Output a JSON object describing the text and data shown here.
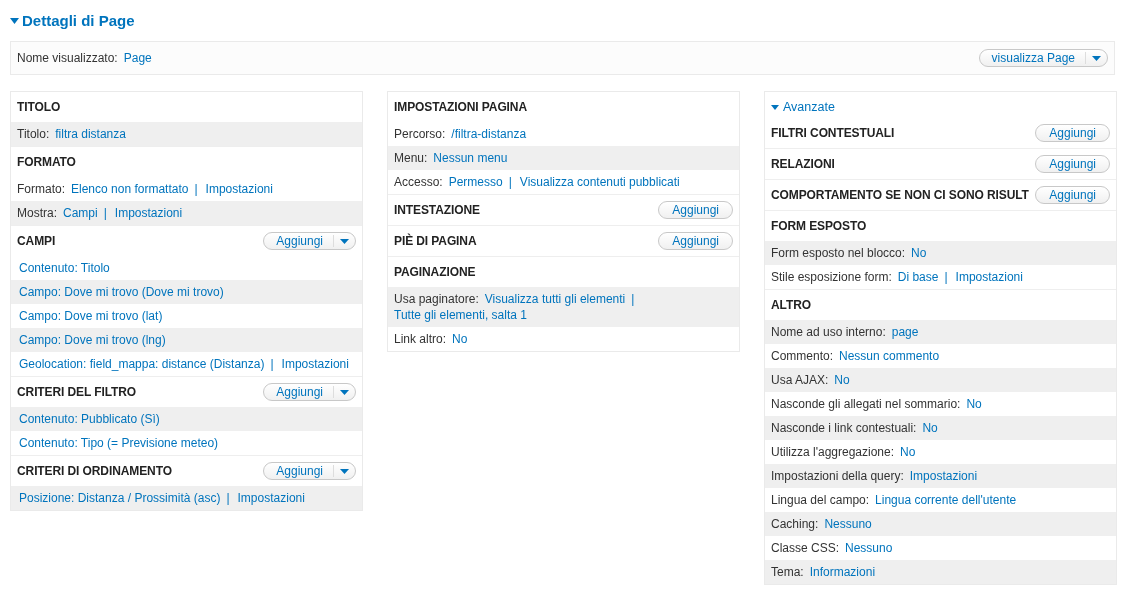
{
  "details": {
    "title": "Dettagli di Page",
    "expanded": true
  },
  "display_name": {
    "label": "Nome visualizzato:",
    "value": "Page",
    "button": "visualizza Page"
  },
  "columns": [
    {
      "sections": [
        {
          "title": "TITOLO",
          "rows": [
            {
              "label": "Titolo:",
              "links": [
                "filtra distanza"
              ],
              "shaded": true
            }
          ]
        },
        {
          "title": "FORMATO",
          "rows": [
            {
              "label": "Formato:",
              "links": [
                "Elenco non formattato",
                "Impostazioni"
              ],
              "separator": "|",
              "shaded": false
            },
            {
              "label": "Mostra:",
              "links": [
                "Campi",
                "Impostazioni"
              ],
              "separator": "|",
              "shaded": true
            }
          ]
        },
        {
          "title": "CAMPI",
          "add": {
            "label": "Aggiungi",
            "kind": "dropbutton"
          },
          "rows": [
            {
              "links": [
                "Contenuto: Titolo"
              ],
              "shaded": false
            },
            {
              "links": [
                "Campo: Dove mi trovo (Dove mi trovo)"
              ],
              "shaded": true
            },
            {
              "links": [
                "Campo: Dove mi trovo (lat)"
              ],
              "shaded": false
            },
            {
              "links": [
                "Campo: Dove mi trovo (lng)"
              ],
              "shaded": true
            },
            {
              "links": [
                "Geolocation: field_mappa: distance (Distanza)",
                "Impostazioni"
              ],
              "separator": "|",
              "shaded": false
            }
          ]
        },
        {
          "title": "CRITERI DEL FILTRO",
          "add": {
            "label": "Aggiungi",
            "kind": "dropbutton"
          },
          "rows": [
            {
              "links": [
                "Contenuto: Pubblicato (Sì)"
              ],
              "shaded": true
            },
            {
              "links": [
                "Contenuto: Tipo (= Previsione meteo)"
              ],
              "shaded": false
            }
          ]
        },
        {
          "title": "CRITERI DI ORDINAMENTO",
          "add": {
            "label": "Aggiungi",
            "kind": "dropbutton"
          },
          "rows": [
            {
              "links": [
                "Posizione: Distanza / Prossimità (asc)",
                "Impostazioni"
              ],
              "separator": "|",
              "shaded": true
            }
          ]
        }
      ]
    },
    {
      "sections": [
        {
          "title": "IMPOSTAZIONI PAGINA",
          "rows": [
            {
              "label": "Percorso:",
              "links": [
                "/filtra-distanza"
              ],
              "shaded": false
            },
            {
              "label": "Menu:",
              "links": [
                "Nessun menu"
              ],
              "shaded": true
            },
            {
              "label": "Accesso:",
              "links": [
                "Permesso",
                "Visualizza contenuti pubblicati"
              ],
              "separator": "|",
              "shaded": false
            }
          ]
        },
        {
          "title": "INTESTAZIONE",
          "add": {
            "label": "Aggiungi",
            "kind": "button"
          }
        },
        {
          "title": "PIÈ DI PAGINA",
          "add": {
            "label": "Aggiungi",
            "kind": "button"
          }
        },
        {
          "title": "PAGINAZIONE",
          "rows": [
            {
              "label": "Usa paginatore:",
              "links": [
                "Visualizza tutti gli elementi",
                "Tutte gli elementi, salta 1"
              ],
              "separator": "|",
              "shaded": true
            },
            {
              "label": "Link altro:",
              "links": [
                "No"
              ],
              "shaded": false
            }
          ]
        }
      ]
    },
    {
      "toggle": {
        "label": "Avanzate",
        "expanded": true
      },
      "sections": [
        {
          "title": "FILTRI CONTESTUALI",
          "add": {
            "label": "Aggiungi",
            "kind": "button"
          }
        },
        {
          "title": "RELAZIONI",
          "add": {
            "label": "Aggiungi",
            "kind": "button"
          }
        },
        {
          "title": "COMPORTAMENTO SE NON CI SONO RISULT",
          "add": {
            "label": "Aggiungi",
            "kind": "button"
          }
        },
        {
          "title": "FORM ESPOSTO",
          "rows": [
            {
              "label": "Form esposto nel blocco:",
              "links": [
                "No"
              ],
              "shaded": true
            },
            {
              "label": "Stile esposizione form:",
              "links": [
                "Di base",
                "Impostazioni"
              ],
              "separator": "|",
              "shaded": false
            }
          ]
        },
        {
          "title": "ALTRO",
          "rows": [
            {
              "label": "Nome ad uso interno:",
              "links": [
                "page"
              ],
              "shaded": true
            },
            {
              "label": "Commento:",
              "links": [
                "Nessun commento"
              ],
              "shaded": false
            },
            {
              "label": "Usa AJAX:",
              "links": [
                "No"
              ],
              "shaded": true
            },
            {
              "label": "Nasconde gli allegati nel sommario:",
              "links": [
                "No"
              ],
              "shaded": false
            },
            {
              "label": "Nasconde i link contestuali:",
              "links": [
                "No"
              ],
              "shaded": true
            },
            {
              "label": "Utilizza l'aggregazione:",
              "links": [
                "No"
              ],
              "shaded": false
            },
            {
              "label": "Impostazioni della query:",
              "links": [
                "Impostazioni"
              ],
              "shaded": true
            },
            {
              "label": "Lingua del campo:",
              "links": [
                "Lingua corrente dell'utente"
              ],
              "shaded": false
            },
            {
              "label": "Caching:",
              "links": [
                "Nessuno"
              ],
              "shaded": true
            },
            {
              "label": "Classe CSS:",
              "links": [
                "Nessuno"
              ],
              "shaded": false
            },
            {
              "label": "Tema:",
              "links": [
                "Informazioni"
              ],
              "shaded": true
            }
          ]
        }
      ]
    }
  ]
}
